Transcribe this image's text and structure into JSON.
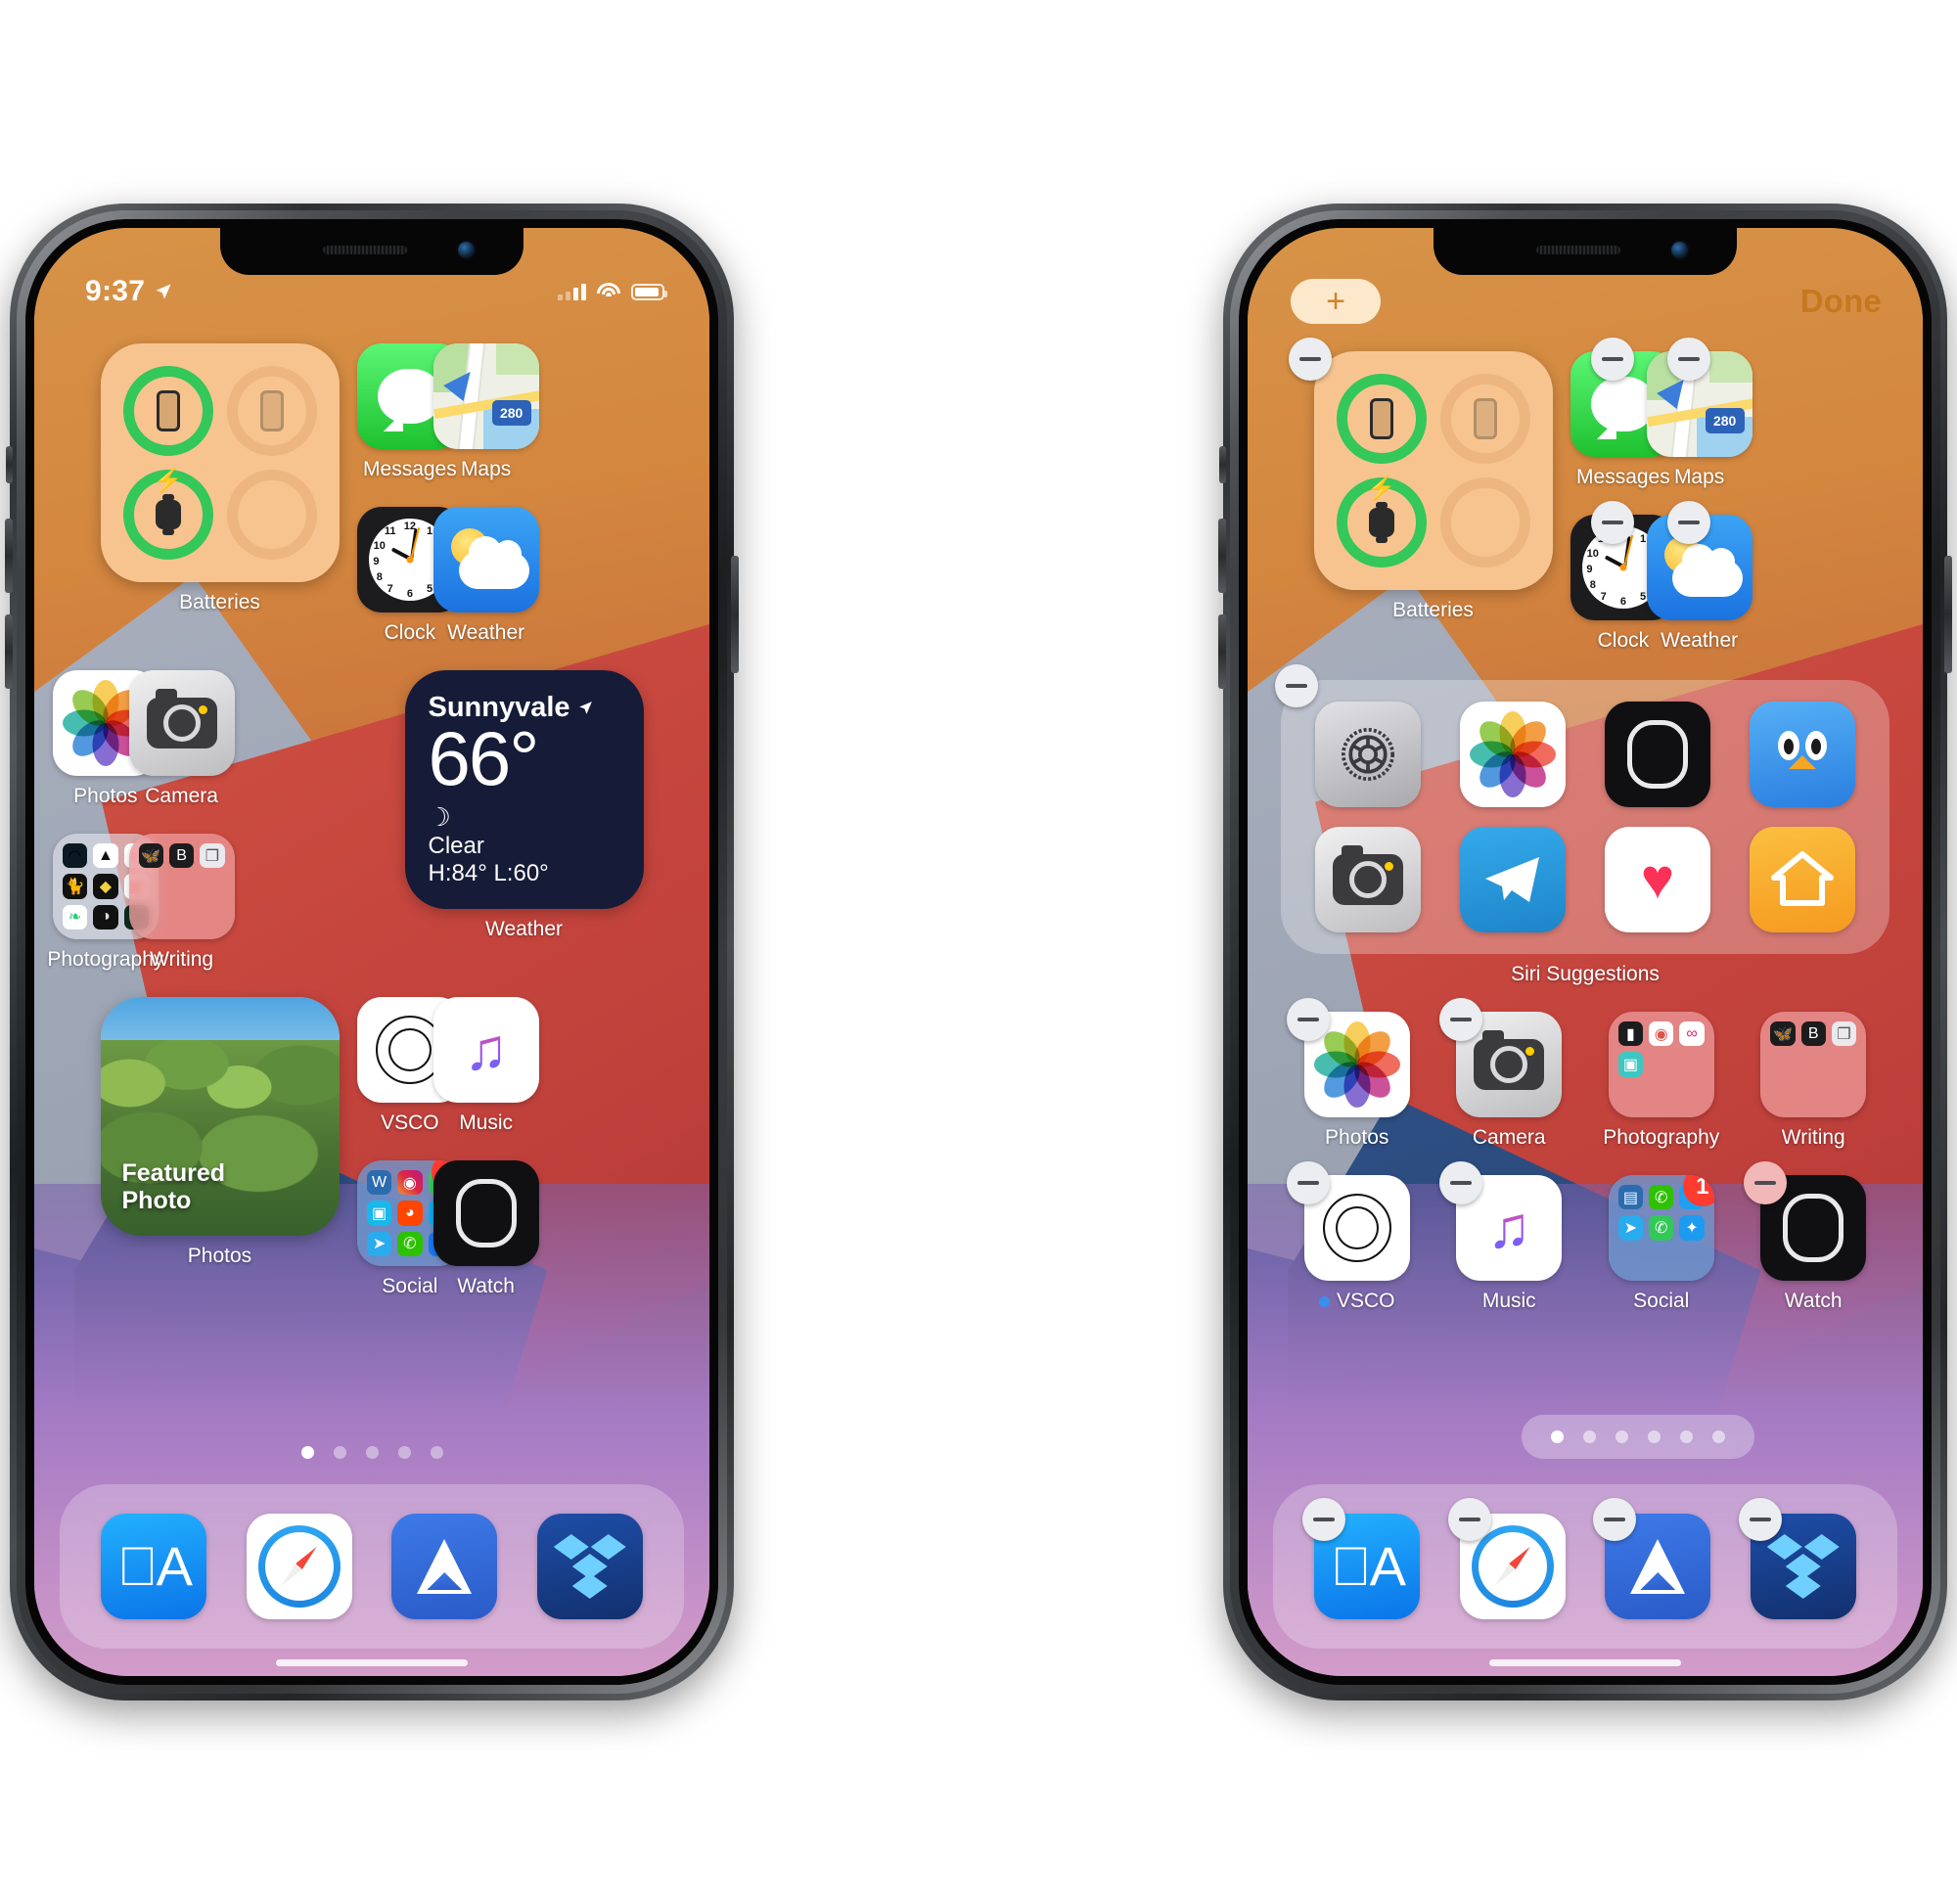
{
  "screens": [
    {
      "id": "home-normal",
      "mode": "normal",
      "status_bar": {
        "time": "9:37",
        "location_icon": "location-arrow-icon",
        "signal_icon": "cellular-signal-icon",
        "wifi_icon": "wifi-icon",
        "battery_icon": "battery-icon"
      },
      "widgets": {
        "batteries": {
          "label": "Batteries",
          "rings": [
            {
              "device": "iphone",
              "charged": true,
              "charging": false
            },
            {
              "device": "ipad",
              "charged": false,
              "charging": false
            },
            {
              "device": "watch",
              "charged": true,
              "charging": true
            },
            {
              "device": "empty",
              "charged": false,
              "charging": false
            }
          ]
        },
        "weather": {
          "label": "Weather",
          "city": "Sunnyvale",
          "location_icon": "location-arrow-icon",
          "temperature": "66°",
          "condition_icon": "moon-stars-icon",
          "condition": "Clear",
          "high_low": "H:84° L:60°"
        },
        "photos": {
          "label": "Photos",
          "caption_line1": "Featured",
          "caption_line2": "Photo"
        }
      },
      "rows": [
        {
          "items": [
            {
              "name": "messages",
              "label": "Messages",
              "icon": "messages-icon"
            },
            {
              "name": "maps",
              "label": "Maps",
              "icon": "maps-icon",
              "badge_text": "280"
            }
          ]
        },
        {
          "items": [
            {
              "name": "clock",
              "label": "Clock",
              "icon": "clock-icon"
            },
            {
              "name": "weather-app",
              "label": "Weather",
              "icon": "weather-icon"
            }
          ]
        },
        {
          "items": [
            {
              "name": "photos-app",
              "label": "Photos",
              "icon": "photos-icon"
            },
            {
              "name": "camera",
              "label": "Camera",
              "icon": "camera-icon"
            }
          ]
        },
        {
          "items": [
            {
              "name": "photography-folder",
              "label": "Photography",
              "icon": "folder-icon"
            },
            {
              "name": "writing-folder",
              "label": "Writing",
              "icon": "folder-icon"
            }
          ]
        },
        {
          "items": [
            {
              "name": "vsco",
              "label": "VSCO",
              "icon": "vsco-icon"
            },
            {
              "name": "music",
              "label": "Music",
              "icon": "music-icon"
            }
          ]
        },
        {
          "items": [
            {
              "name": "social-folder",
              "label": "Social",
              "icon": "folder-icon",
              "badge": "1"
            },
            {
              "name": "watch",
              "label": "Watch",
              "icon": "watch-icon"
            }
          ]
        }
      ],
      "page_dots": {
        "count": 5,
        "active_index": 0
      },
      "dock": [
        {
          "name": "app-store",
          "icon": "app-store-icon",
          "glyph": "A"
        },
        {
          "name": "safari",
          "icon": "safari-icon"
        },
        {
          "name": "spark-mail",
          "icon": "paper-plane-icon"
        },
        {
          "name": "dropbox",
          "icon": "dropbox-icon"
        }
      ]
    },
    {
      "id": "home-edit",
      "mode": "edit",
      "top_bar": {
        "add_label": "+",
        "add_icon": "plus-icon",
        "done_label": "Done"
      },
      "widgets": {
        "batteries": {
          "label": "Batteries",
          "rings": [
            {
              "device": "iphone",
              "charged": true,
              "charging": false
            },
            {
              "device": "ipad",
              "charged": false,
              "charging": false
            },
            {
              "device": "watch",
              "charged": true,
              "charging": true
            },
            {
              "device": "empty",
              "charged": false,
              "charging": false
            }
          ]
        },
        "siri_suggestions": {
          "label": "Siri Suggestions",
          "apps": [
            {
              "name": "settings",
              "icon": "settings-gear-icon"
            },
            {
              "name": "photos",
              "icon": "photos-icon"
            },
            {
              "name": "watch",
              "icon": "watch-icon"
            },
            {
              "name": "tweetbot",
              "icon": "tweetbot-bird-icon"
            },
            {
              "name": "camera",
              "icon": "camera-icon"
            },
            {
              "name": "telegram",
              "icon": "telegram-icon"
            },
            {
              "name": "health",
              "icon": "health-heart-icon"
            },
            {
              "name": "home",
              "icon": "home-house-icon"
            }
          ]
        }
      },
      "rows": [
        {
          "items": [
            {
              "name": "messages",
              "label": "Messages",
              "icon": "messages-icon"
            },
            {
              "name": "maps",
              "label": "Maps",
              "icon": "maps-icon",
              "badge_text": "280"
            }
          ]
        },
        {
          "items": [
            {
              "name": "clock",
              "label": "Clock",
              "icon": "clock-icon"
            },
            {
              "name": "weather-app",
              "label": "Weather",
              "icon": "weather-icon"
            }
          ]
        },
        {
          "items": [
            {
              "name": "photos-app",
              "label": "Photos",
              "icon": "photos-icon"
            },
            {
              "name": "camera",
              "label": "Camera",
              "icon": "camera-icon"
            },
            {
              "name": "photography-folder",
              "label": "Photography",
              "icon": "folder-icon"
            },
            {
              "name": "writing-folder",
              "label": "Writing",
              "icon": "folder-icon"
            }
          ]
        },
        {
          "items": [
            {
              "name": "vsco",
              "label": "VSCO",
              "icon": "vsco-icon",
              "new_dot": true
            },
            {
              "name": "music",
              "label": "Music",
              "icon": "music-icon"
            },
            {
              "name": "social-folder",
              "label": "Social",
              "icon": "folder-icon",
              "badge": "1"
            },
            {
              "name": "watch",
              "label": "Watch",
              "icon": "watch-icon"
            }
          ]
        }
      ],
      "page_dots": {
        "count": 6,
        "active_index": 0
      },
      "dock": [
        {
          "name": "app-store",
          "icon": "app-store-icon",
          "glyph": "A"
        },
        {
          "name": "safari",
          "icon": "safari-icon"
        },
        {
          "name": "spark-mail",
          "icon": "paper-plane-icon"
        },
        {
          "name": "dropbox",
          "icon": "dropbox-icon"
        }
      ]
    }
  ],
  "colors": {
    "accent_green": "#34c759",
    "badge_red": "#ff3b30",
    "done_orange": "#c6781f",
    "widget_batteries_bg": "#f7c48f",
    "weather_widget_bg": "#161b38"
  },
  "labels": {
    "s1_batteries": "Batteries",
    "s1_messages": "Messages",
    "s1_maps": "Maps",
    "s1_clock": "Clock",
    "s1_weather": "Weather",
    "s1_photos": "Photos",
    "s1_camera": "Camera",
    "s1_photography": "Photography",
    "s1_writing": "Writing",
    "s1_weather_widget": "Weather",
    "s1_photos_widget": "Photos",
    "s1_vsco": "VSCO",
    "s1_music": "Music",
    "s1_social": "Social",
    "s1_watch": "Watch",
    "s2_batteries": "Batteries",
    "s2_messages": "Messages",
    "s2_maps": "Maps",
    "s2_clock": "Clock",
    "s2_weather": "Weather",
    "s2_siri": "Siri Suggestions",
    "s2_photos": "Photos",
    "s2_camera": "Camera",
    "s2_photography": "Photography",
    "s2_writing": "Writing",
    "s2_vsco": "VSCO",
    "s2_music": "Music",
    "s2_social": "Social",
    "s2_watch": "Watch"
  },
  "weather": {
    "city": "Sunnyvale",
    "temp": "66°",
    "condition": "Clear",
    "high_low": "H:84° L:60°"
  },
  "photo_widget": {
    "line1": "Featured",
    "line2": "Photo"
  },
  "status": {
    "time": "9:37"
  },
  "edit": {
    "plus": "+",
    "done": "Done"
  },
  "maps_badge": "280",
  "social_badge_1": "1",
  "social_badge_2": "1"
}
